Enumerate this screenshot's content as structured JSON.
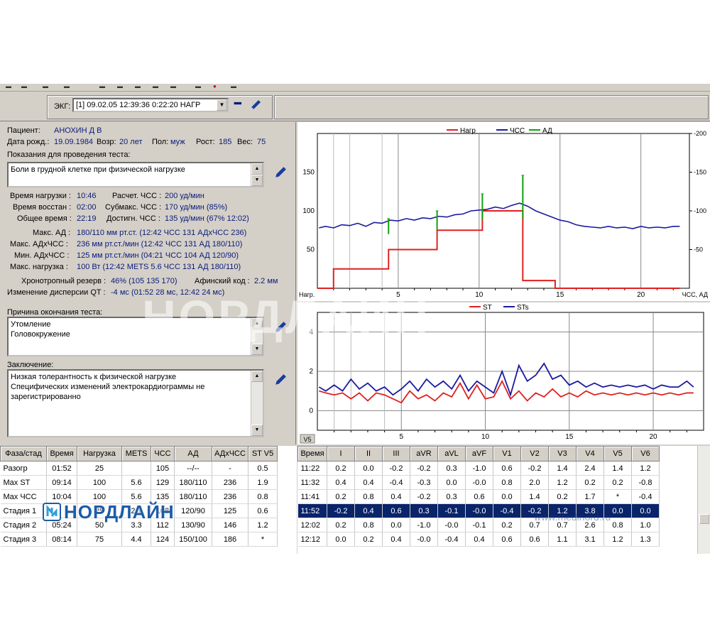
{
  "toolbar": {
    "ecg_label": "ЭКГ:",
    "ecg_record": "[1] 09.02.05 12:39:36  0:22:20 НАГР"
  },
  "patient": {
    "patient_label": "Пациент:",
    "name": "АНОХИН Д В",
    "dob_label": "Дата рожд.:",
    "dob": "19.09.1984",
    "age_label": "Возр:",
    "age": "20 лет",
    "sex_label": "Пол:",
    "sex": "муж",
    "height_label": "Рост:",
    "height": "185",
    "weight_label": "Вес:",
    "weight": "75"
  },
  "indications": {
    "label": "Показания для проведения теста:",
    "text": "Боли в грудной клетке при физической нагрузке"
  },
  "stats": {
    "load_time_label": "Время нагрузки :",
    "load_time": "10:46",
    "calc_hr_label": "Расчет. ЧСС :",
    "calc_hr": "200 уд/мин",
    "recovery_label": "Время восстан :",
    "recovery": "02:00",
    "submax_label": "Субмакс. ЧСС :",
    "submax": "170 уд/мин (85%)",
    "total_label": "Общее время :",
    "total": "22:19",
    "reached_label": "Достигн. ЧСС :",
    "reached": "135 уд/мин (67% 12:02)",
    "max_bp_label": "Макс. АД :",
    "max_bp": "180/110 мм рт.ст. (12:42 ЧСС 131 АДхЧСС 236)",
    "max_dp_label": "Макс. АДхЧСС :",
    "max_dp": "236 мм рт.ст./мин (12:42 ЧСС 131 АД 180/110)",
    "min_dp_label": "Мин. АДхЧСС :",
    "min_dp": "125 мм рт.ст./мин (04:21 ЧСС 104 АД 120/90)",
    "max_load_label": "Макс. нагрузка :",
    "max_load": "100 Вт (12:42 METS 5.6 ЧСС 131 АД 180/110)",
    "chrono_label": "Хронотропный резерв :",
    "chrono": "46% (105 135 170)",
    "inotropic_label": "Афинский код :",
    "inotropic": "2.2 мм",
    "qt_label": "Изменение дисперсии QT :",
    "qt": "-4 мс (01:52 28 мс, 12:42 24 мс)"
  },
  "termination": {
    "label": "Причина окончания теста:",
    "line1": "Утомление",
    "line2": "Головокружение"
  },
  "conclusion": {
    "label": "Заключение:",
    "line1": "Низкая толерантность к физической нагрузке",
    "line2": "Специфических изменений электрокардиограммы не",
    "line3": "зарегистрированно"
  },
  "chart_data": [
    {
      "type": "line",
      "legend": [
        "Нагр",
        "ЧСС",
        "АД"
      ],
      "legend_placement": "top-center",
      "colors": {
        "load": "#e02020",
        "hr": "#1a1aa0",
        "bp": "#10a010"
      },
      "x_ticks": [
        5,
        10,
        15,
        20
      ],
      "xlim": [
        0,
        23
      ],
      "ylim": [
        0,
        200
      ],
      "y_left_ticks": [
        50,
        100,
        150
      ],
      "y_right_ticks": [
        50,
        100,
        150,
        200
      ],
      "x_start_label": "Нагр.",
      "x_end_label": "ЧСС, АД",
      "grid_x": true,
      "load_steps": [
        [
          0,
          0
        ],
        [
          1,
          0
        ],
        [
          1,
          25
        ],
        [
          4.4,
          25
        ],
        [
          4.4,
          50
        ],
        [
          7.4,
          50
        ],
        [
          7.4,
          75
        ],
        [
          10.2,
          75
        ],
        [
          10.2,
          100
        ],
        [
          12.7,
          100
        ],
        [
          12.7,
          10
        ],
        [
          14.7,
          10
        ],
        [
          14.7,
          0
        ],
        [
          22.4,
          0
        ]
      ],
      "hr": [
        [
          0.1,
          78
        ],
        [
          0.5,
          80
        ],
        [
          1,
          78
        ],
        [
          1.5,
          82
        ],
        [
          2,
          81
        ],
        [
          2.5,
          84
        ],
        [
          3,
          80
        ],
        [
          3.5,
          85
        ],
        [
          4,
          84
        ],
        [
          4.5,
          88
        ],
        [
          5,
          87
        ],
        [
          5.5,
          90
        ],
        [
          6,
          88
        ],
        [
          6.5,
          91
        ],
        [
          7,
          90
        ],
        [
          7.5,
          93
        ],
        [
          8,
          92
        ],
        [
          8.5,
          95
        ],
        [
          9,
          96
        ],
        [
          9.5,
          100
        ],
        [
          10,
          101
        ],
        [
          10.5,
          102
        ],
        [
          11,
          105
        ],
        [
          11.5,
          103
        ],
        [
          12,
          107
        ],
        [
          12.5,
          110
        ],
        [
          13,
          106
        ],
        [
          13.5,
          100
        ],
        [
          14,
          96
        ],
        [
          14.5,
          92
        ],
        [
          15,
          88
        ],
        [
          15.5,
          86
        ],
        [
          16,
          82
        ],
        [
          16.5,
          80
        ],
        [
          17,
          79
        ],
        [
          17.5,
          78
        ],
        [
          18,
          80
        ],
        [
          18.5,
          78
        ],
        [
          19,
          79
        ],
        [
          19.5,
          77
        ],
        [
          20,
          80
        ],
        [
          20.5,
          78
        ],
        [
          21,
          79
        ],
        [
          21.5,
          78
        ],
        [
          22,
          80
        ],
        [
          22.4,
          80
        ]
      ],
      "bp": [
        [
          4.4,
          70,
          90
        ],
        [
          7.4,
          75,
          100
        ],
        [
          10.2,
          88,
          122
        ],
        [
          12.7,
          90,
          146
        ]
      ]
    },
    {
      "type": "line",
      "legend": [
        "ST",
        "STs"
      ],
      "legend_placement": "top-center",
      "colors": {
        "ST": "#e02020",
        "STs": "#1a1aa0"
      },
      "x_ticks": [
        5,
        10,
        15,
        20
      ],
      "xlim": [
        0,
        23
      ],
      "ylim": [
        -1,
        5
      ],
      "y_ticks": [
        0,
        2,
        4
      ],
      "x_start_label": "V5",
      "grid_x": true,
      "ST": [
        [
          0.1,
          1.0
        ],
        [
          0.5,
          0.9
        ],
        [
          1,
          0.8
        ],
        [
          1.5,
          0.9
        ],
        [
          2,
          0.6
        ],
        [
          2.5,
          0.9
        ],
        [
          3,
          0.5
        ],
        [
          3.5,
          0.9
        ],
        [
          4,
          0.8
        ],
        [
          4.5,
          0.6
        ],
        [
          5,
          0.4
        ],
        [
          5.5,
          1.0
        ],
        [
          6,
          0.6
        ],
        [
          6.5,
          0.8
        ],
        [
          7,
          0.5
        ],
        [
          7.5,
          0.9
        ],
        [
          8,
          0.7
        ],
        [
          8.5,
          1.4
        ],
        [
          9,
          0.6
        ],
        [
          9.5,
          1.3
        ],
        [
          10,
          0.6
        ],
        [
          10.5,
          0.7
        ],
        [
          11,
          1.5
        ],
        [
          11.5,
          0.6
        ],
        [
          12,
          1.0
        ],
        [
          12.5,
          0.5
        ],
        [
          13,
          0.9
        ],
        [
          13.5,
          0.7
        ],
        [
          14,
          1.1
        ],
        [
          14.5,
          0.7
        ],
        [
          15,
          0.9
        ],
        [
          15.5,
          0.7
        ],
        [
          16,
          1.0
        ],
        [
          16.5,
          0.8
        ],
        [
          17,
          0.9
        ],
        [
          17.5,
          0.8
        ],
        [
          18,
          0.9
        ],
        [
          18.5,
          0.8
        ],
        [
          19,
          0.9
        ],
        [
          19.5,
          0.8
        ],
        [
          20,
          0.9
        ],
        [
          20.5,
          0.8
        ],
        [
          21,
          0.9
        ],
        [
          21.5,
          0.8
        ],
        [
          22,
          0.9
        ],
        [
          22.4,
          0.9
        ]
      ],
      "STs": [
        [
          0.1,
          1.2
        ],
        [
          0.5,
          1.0
        ],
        [
          1,
          1.3
        ],
        [
          1.5,
          1.0
        ],
        [
          2,
          1.6
        ],
        [
          2.5,
          1.1
        ],
        [
          3,
          1.4
        ],
        [
          3.5,
          1.0
        ],
        [
          4,
          1.2
        ],
        [
          4.5,
          0.8
        ],
        [
          5,
          1.1
        ],
        [
          5.5,
          1.5
        ],
        [
          6,
          1.0
        ],
        [
          6.5,
          1.6
        ],
        [
          7,
          1.2
        ],
        [
          7.5,
          1.5
        ],
        [
          8,
          1.1
        ],
        [
          8.5,
          1.8
        ],
        [
          9,
          1.0
        ],
        [
          9.5,
          1.5
        ],
        [
          10,
          1.2
        ],
        [
          10.5,
          0.9
        ],
        [
          11,
          2.0
        ],
        [
          11.5,
          0.8
        ],
        [
          12,
          2.3
        ],
        [
          12.5,
          1.5
        ],
        [
          13,
          1.8
        ],
        [
          13.5,
          2.4
        ],
        [
          14,
          1.6
        ],
        [
          14.5,
          1.8
        ],
        [
          15,
          1.3
        ],
        [
          15.5,
          1.5
        ],
        [
          16,
          1.2
        ],
        [
          16.5,
          1.4
        ],
        [
          17,
          1.2
        ],
        [
          17.5,
          1.3
        ],
        [
          18,
          1.2
        ],
        [
          18.5,
          1.3
        ],
        [
          19,
          1.2
        ],
        [
          19.5,
          1.3
        ],
        [
          20,
          1.1
        ],
        [
          20.5,
          1.3
        ],
        [
          21,
          1.2
        ],
        [
          21.5,
          1.2
        ],
        [
          22,
          1.5
        ],
        [
          22.4,
          1.2
        ]
      ]
    }
  ],
  "phase_table": {
    "headers": [
      "Фаза/стад",
      "Время",
      "Нагрузка",
      "METS",
      "ЧСС",
      "АД",
      "АДхЧСС",
      "ST V5"
    ],
    "rows": [
      [
        "Разогр",
        "01:52",
        "25",
        "",
        "105",
        "--/--",
        "-",
        "0.5"
      ],
      [
        "Max ST",
        "09:14",
        "100",
        "5.6",
        "129",
        "180/110",
        "236",
        "1.9"
      ],
      [
        "Max ЧСС",
        "10:04",
        "100",
        "5.6",
        "135",
        "180/110",
        "236",
        "0.8"
      ],
      [
        "Стадия 1",
        "",
        "25",
        "2.1",
        "108",
        "120/90",
        "125",
        "0.6"
      ],
      [
        "Стадия 2",
        "05:24",
        "50",
        "3.3",
        "112",
        "130/90",
        "146",
        "1.2"
      ],
      [
        "Стадия 3",
        "08:14",
        "75",
        "4.4",
        "124",
        "150/100",
        "186",
        "*"
      ]
    ]
  },
  "lead_table": {
    "headers": [
      "Время",
      "I",
      "II",
      "III",
      "aVR",
      "aVL",
      "aVF",
      "V1",
      "V2",
      "V3",
      "V4",
      "V5",
      "V6"
    ],
    "selected_row": 3,
    "rows": [
      [
        "11:22",
        "0.2",
        "0.0",
        "-0.2",
        "-0.2",
        "0.3",
        "-1.0",
        "0.6",
        "-0.2",
        "1.4",
        "2.4",
        "1.4",
        "1.2"
      ],
      [
        "11:32",
        "0.4",
        "0.4",
        "-0.4",
        "-0.3",
        "0.0",
        "-0.0",
        "0.8",
        "2.0",
        "1.2",
        "0.2",
        "0.2",
        "-0.8"
      ],
      [
        "11:41",
        "0.2",
        "0.8",
        "0.4",
        "-0.2",
        "0.3",
        "0.6",
        "0.0",
        "1.4",
        "0.2",
        "1.7",
        "*",
        "-0.4"
      ],
      [
        "11:52",
        "-0.2",
        "0.4",
        "0.6",
        "0.3",
        "-0.1",
        "-0.0",
        "-0.4",
        "-0.2",
        "1.2",
        "3.8",
        "0.0",
        "0.0"
      ],
      [
        "12:02",
        "0.2",
        "0.8",
        "0.0",
        "-1.0",
        "-0.0",
        "-0.1",
        "0.2",
        "0.7",
        "0.7",
        "2.6",
        "0.8",
        "1.0"
      ],
      [
        "12:12",
        "0.0",
        "0.2",
        "0.4",
        "-0.0",
        "-0.4",
        "0.4",
        "0.6",
        "0.6",
        "1.1",
        "3.1",
        "1.2",
        "1.3"
      ]
    ]
  },
  "branding": {
    "logo_text": "НОРДЛАЙН",
    "url": "www.medinord.ru",
    "watermark": "НОРДЛАЙН"
  }
}
